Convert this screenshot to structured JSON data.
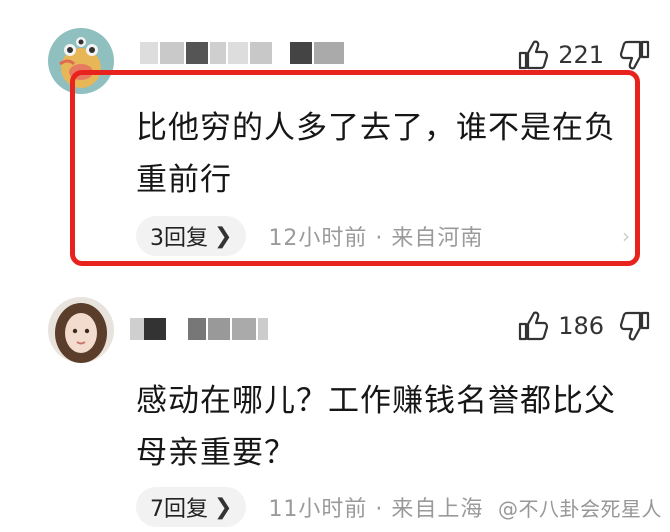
{
  "comments": [
    {
      "likes": "221",
      "text": "比他穷的人多了去了，谁不是在负重前行",
      "replies_label": "3回复",
      "time": "12小时前 · 来自河南"
    },
    {
      "likes": "186",
      "text": "感动在哪儿？工作赚钱名誉都比父母亲重要？",
      "replies_label": "7回复",
      "time": "11小时前 · 来自上海"
    }
  ],
  "watermark": "@不八卦会死星人",
  "colors": {
    "highlight": "#e8231d",
    "meta_text": "#9a9a9a",
    "pill_bg": "#f2f2f2"
  },
  "icons": [
    "thumbs-up-icon",
    "thumbs-down-icon",
    "chevron-right-icon"
  ]
}
